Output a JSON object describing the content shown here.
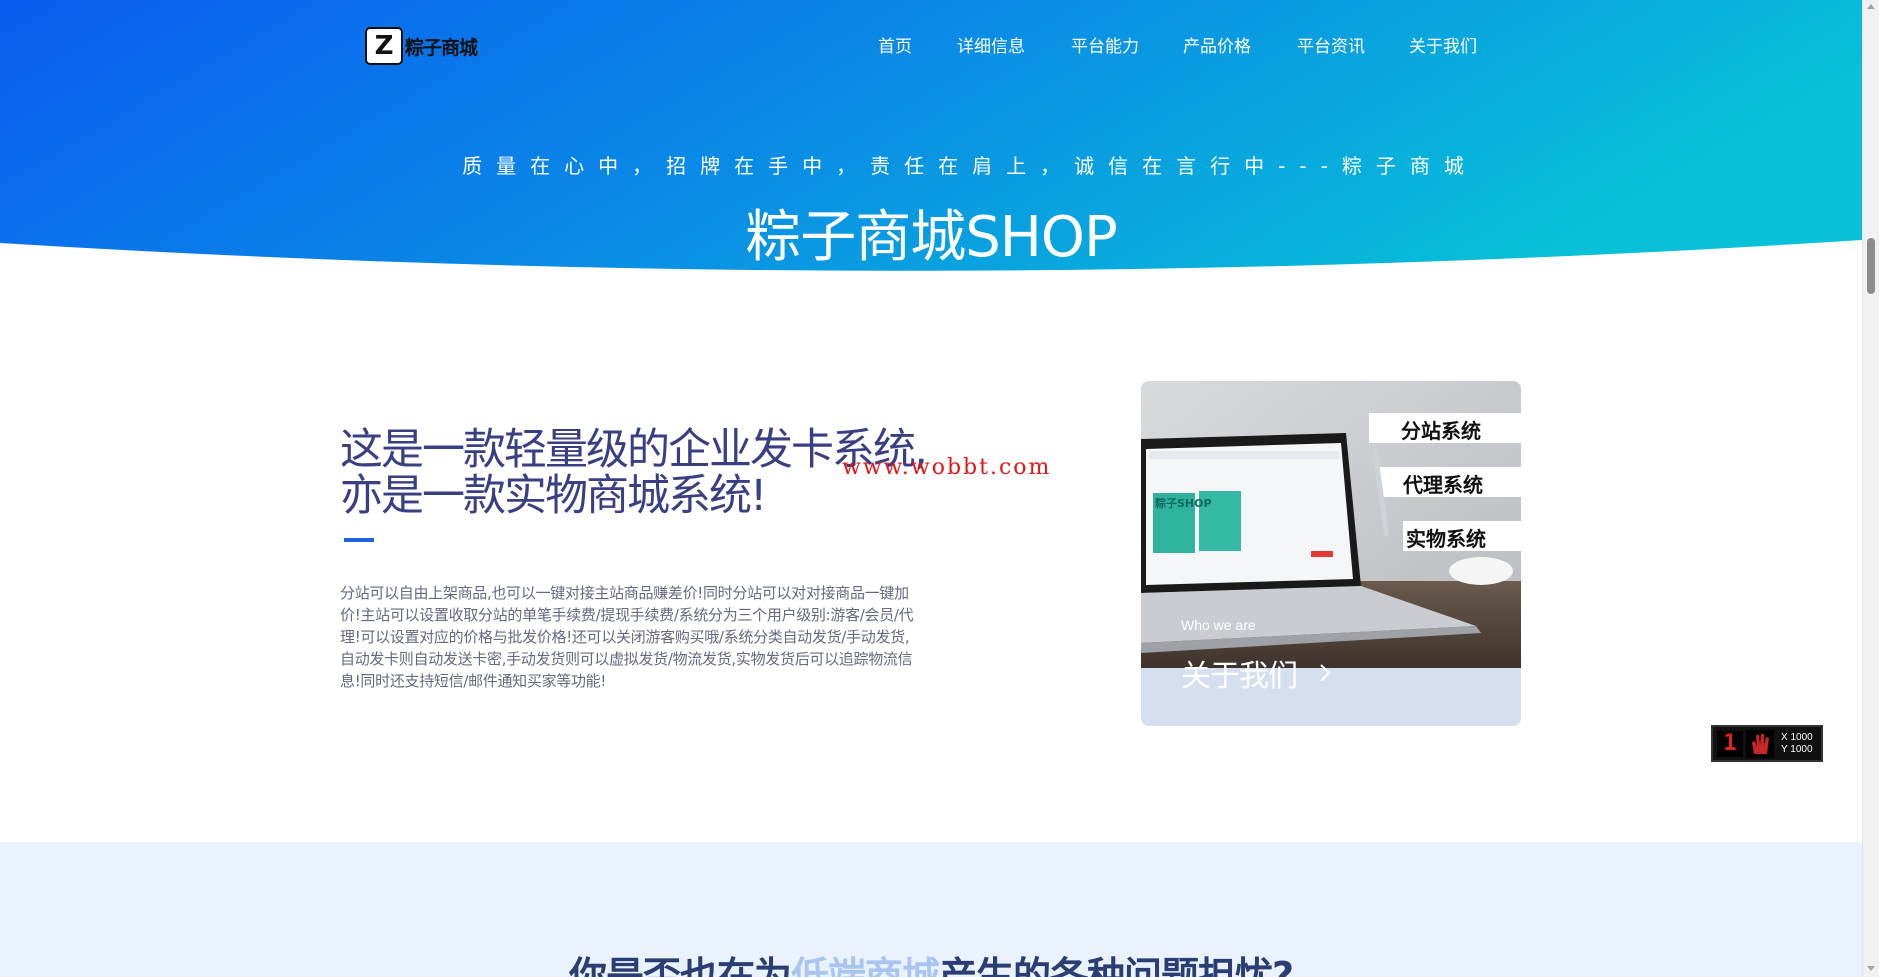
{
  "brand": {
    "logo_letter": "Z",
    "logo_text": "粽子商城"
  },
  "nav": {
    "items": [
      "首页",
      "详细信息",
      "平台能力",
      "产品价格",
      "平台资讯",
      "关于我们"
    ]
  },
  "hero": {
    "slogan": "质量在心中，招牌在手中，责任在肩上，诚信在言行中---粽子商城",
    "title": "粽子商城SHOP"
  },
  "intro": {
    "heading_line1": "这是一款轻量级的企业发卡系统,",
    "heading_line2": "亦是一款实物商城系统!",
    "description": "分站可以自由上架商品,也可以一键对接主站商品赚差价!同时分站可以对对接商品一键加价!主站可以设置收取分站的单笔手续费/提现手续费/系统分为三个用户级别:游客/会员/代理!可以设置对应的价格与批发价格!还可以关闭游客购买哦/系统分类自动发货/手动发货,自动发卡则自动发送卡密,手动发货则可以虚拟发货/物流发货,实物发货后可以追踪物流信息!同时还支持短信/邮件通知买家等功能!",
    "watermark": "www.wobbt.com"
  },
  "card": {
    "subtitle": "Who we are",
    "title": "关于我们",
    "image_labels": [
      "分站系统",
      "代理系统",
      "实物系统"
    ],
    "screen_logo": "粽子SHOP"
  },
  "counter": {
    "digit": "1",
    "x_label": "X 1000",
    "y_label": "Y 1000"
  },
  "section2": {
    "title_before": "你是否也在为",
    "title_highlight": "低端商城",
    "title_after": "产生的各种问题担忧?"
  },
  "colors": {
    "hero_gradient_start": "#0a5cf0",
    "hero_gradient_end": "#08c0d8",
    "heading": "#3a3f83",
    "accent_bar": "#1f63d6",
    "watermark": "#e01818",
    "section2_bg": "#eaf3fd"
  }
}
